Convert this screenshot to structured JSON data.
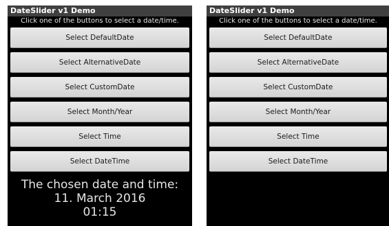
{
  "left": {
    "title": "DateSlider v1 Demo",
    "instructions": "Click one of the buttons to select a date/time.",
    "buttons": [
      {
        "label": "Select DefaultDate"
      },
      {
        "label": "Select AlternativeDate"
      },
      {
        "label": "Select CustomDate"
      },
      {
        "label": "Select Month/Year"
      },
      {
        "label": "Select Time"
      },
      {
        "label": "Select DateTime"
      }
    ],
    "result": {
      "line1": "The chosen date and time:",
      "line2": "11. March 2016",
      "line3": "01:15"
    }
  },
  "right": {
    "title": "DateSlider v1 Demo",
    "instructions": "Click one of the buttons to select a date/time.",
    "buttons": [
      {
        "label": "Select DefaultDate"
      },
      {
        "label": "Select AlternativeDate"
      },
      {
        "label": "Select CustomDate"
      },
      {
        "label": "Select Month/Year"
      },
      {
        "label": "Select Time"
      },
      {
        "label": "Select DateTime"
      }
    ]
  }
}
